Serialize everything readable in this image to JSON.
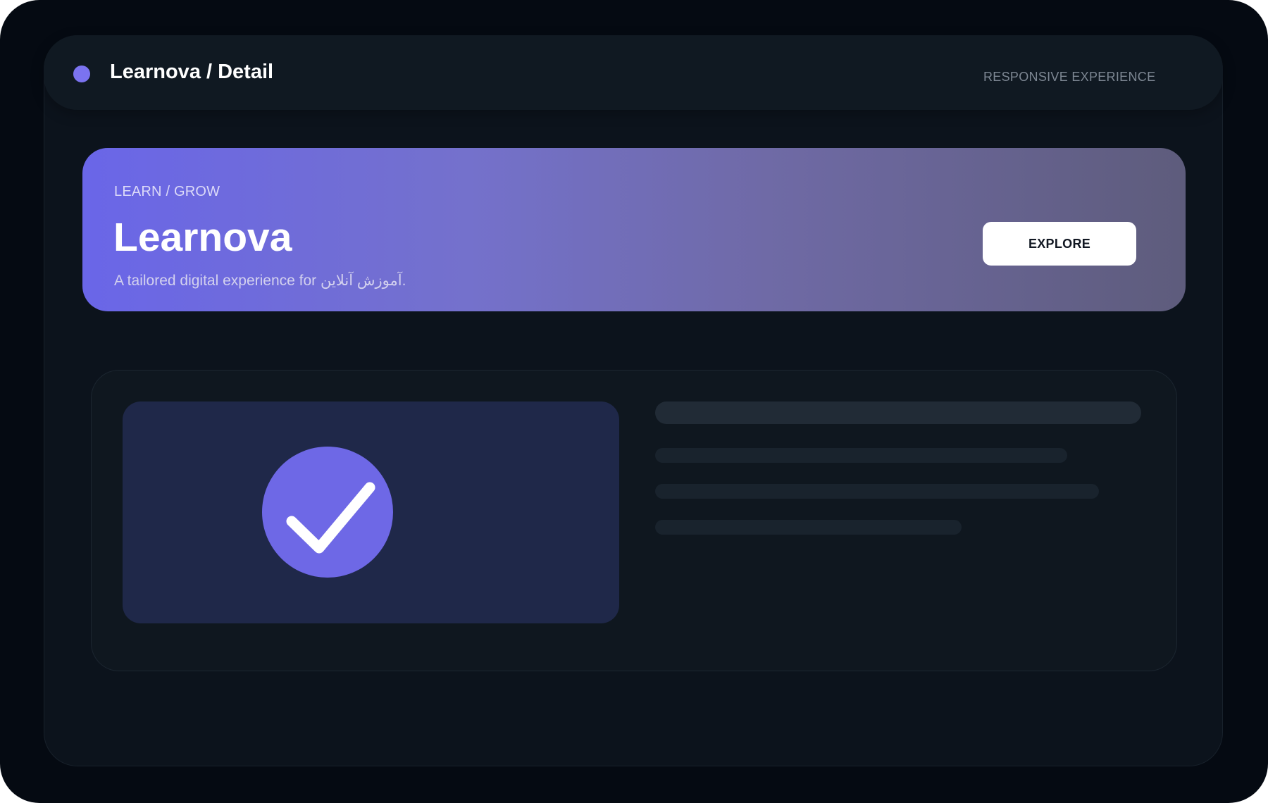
{
  "header": {
    "title": "Learnova / Detail",
    "tag": "RESPONSIVE EXPERIENCE",
    "dot_color": "#7b73f0"
  },
  "hero": {
    "eyebrow": "LEARN / GROW",
    "title": "Learnova",
    "subtitle": "A tailored digital experience for آموزش آنلاین.",
    "cta_label": "EXPLORE"
  },
  "content": {
    "media_icon": "check-icon",
    "accent_color": "#6e68e6"
  },
  "colors": {
    "background": "#050a12",
    "surface": "#0c131c",
    "panel": "#1f2849",
    "accent": "#6e68e6"
  }
}
